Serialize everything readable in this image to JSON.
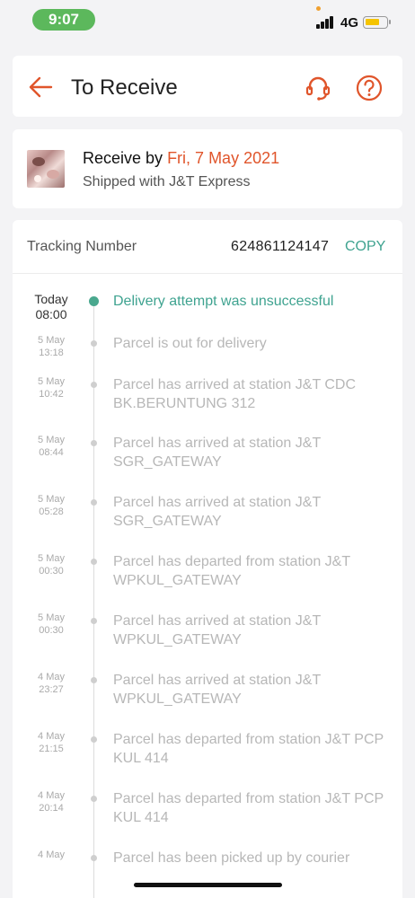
{
  "status_bar": {
    "time": "9:07",
    "network": "4G",
    "time_pill_color": "#5cb85c",
    "battery_color": "#f5c400"
  },
  "header": {
    "title": "To Receive",
    "back_icon": "arrow-left-icon",
    "support_icon": "headset-icon",
    "help_icon": "question-circle-icon",
    "accent_color": "#e0552b"
  },
  "receive": {
    "label": "Receive by",
    "date": "Fri, 7 May 2021",
    "shipped": "Shipped with J&T Express"
  },
  "tracking": {
    "label": "Tracking Number",
    "number": "624861124147",
    "copy_label": "COPY",
    "accent_color": "#3fa390",
    "events": [
      {
        "date": "Today",
        "time": "08:00",
        "text": "Delivery attempt was unsuccessful",
        "current": true
      },
      {
        "date": "5 May",
        "time": "13:18",
        "text": "Parcel is out for delivery"
      },
      {
        "date": "5 May",
        "time": "10:42",
        "text": "Parcel has arrived at station J&T CDC BK.BERUNTUNG 312"
      },
      {
        "date": "5 May",
        "time": "08:44",
        "text": "Parcel has arrived at station J&T SGR_GATEWAY"
      },
      {
        "date": "5 May",
        "time": "05:28",
        "text": "Parcel has arrived at station J&T SGR_GATEWAY"
      },
      {
        "date": "5 May",
        "time": "00:30",
        "text": "Parcel has departed from station J&T WPKUL_GATEWAY"
      },
      {
        "date": "5 May",
        "time": "00:30",
        "text": "Parcel has arrived at station J&T WPKUL_GATEWAY"
      },
      {
        "date": "4 May",
        "time": "23:27",
        "text": "Parcel has arrived at station J&T WPKUL_GATEWAY"
      },
      {
        "date": "4 May",
        "time": "21:15",
        "text": "Parcel has departed from station J&T PCP KUL 414"
      },
      {
        "date": "4 May",
        "time": "20:14",
        "text": "Parcel has departed from station J&T PCP KUL 414"
      },
      {
        "date": "4 May",
        "time": "",
        "text": "Parcel has been picked up by courier"
      }
    ]
  }
}
